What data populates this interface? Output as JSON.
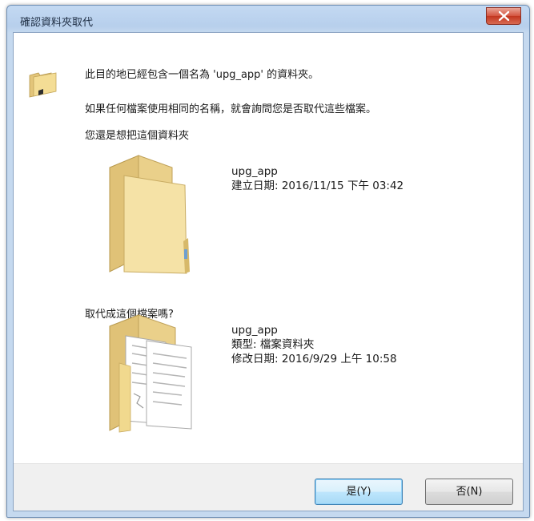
{
  "window": {
    "title": "確認資料夾取代",
    "close_icon": "close-x-icon"
  },
  "message": {
    "line1": "此目的地已經包含一個名為 'upg_app' 的資料夾。",
    "line2": "如果任何檔案使用相同的名稱，就會詢問您是否取代這些檔案。",
    "line3": "您還是想把這個資料夾",
    "line4": "取代成這個檔案嗎?"
  },
  "destination": {
    "icon": "empty-folder-icon",
    "name": "upg_app",
    "created": "建立日期: 2016/11/15 下午 03:42"
  },
  "source": {
    "icon": "folder-with-files-icon",
    "name": "upg_app",
    "type": "類型: 檔案資料夾",
    "modified": "修改日期: 2016/9/29 上午 10:58"
  },
  "buttons": {
    "yes": "是(Y)",
    "no": "否(N)"
  },
  "colors": {
    "titlebar": "#c3d9f2",
    "close_button": "#c2361f",
    "folder": "#f1d98e",
    "default_button_border": "#3c7fb1"
  }
}
